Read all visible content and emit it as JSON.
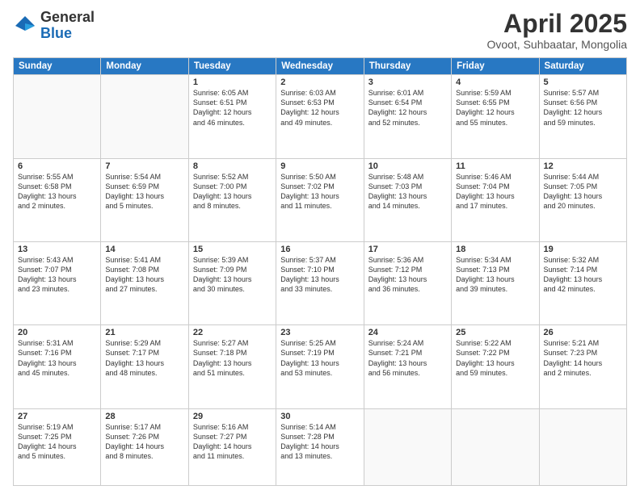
{
  "logo": {
    "general": "General",
    "blue": "Blue"
  },
  "title": "April 2025",
  "subtitle": "Ovoot, Suhbaatar, Mongolia",
  "days_header": [
    "Sunday",
    "Monday",
    "Tuesday",
    "Wednesday",
    "Thursday",
    "Friday",
    "Saturday"
  ],
  "weeks": [
    [
      {
        "day": "",
        "detail": ""
      },
      {
        "day": "",
        "detail": ""
      },
      {
        "day": "1",
        "detail": "Sunrise: 6:05 AM\nSunset: 6:51 PM\nDaylight: 12 hours\nand 46 minutes."
      },
      {
        "day": "2",
        "detail": "Sunrise: 6:03 AM\nSunset: 6:53 PM\nDaylight: 12 hours\nand 49 minutes."
      },
      {
        "day": "3",
        "detail": "Sunrise: 6:01 AM\nSunset: 6:54 PM\nDaylight: 12 hours\nand 52 minutes."
      },
      {
        "day": "4",
        "detail": "Sunrise: 5:59 AM\nSunset: 6:55 PM\nDaylight: 12 hours\nand 55 minutes."
      },
      {
        "day": "5",
        "detail": "Sunrise: 5:57 AM\nSunset: 6:56 PM\nDaylight: 12 hours\nand 59 minutes."
      }
    ],
    [
      {
        "day": "6",
        "detail": "Sunrise: 5:55 AM\nSunset: 6:58 PM\nDaylight: 13 hours\nand 2 minutes."
      },
      {
        "day": "7",
        "detail": "Sunrise: 5:54 AM\nSunset: 6:59 PM\nDaylight: 13 hours\nand 5 minutes."
      },
      {
        "day": "8",
        "detail": "Sunrise: 5:52 AM\nSunset: 7:00 PM\nDaylight: 13 hours\nand 8 minutes."
      },
      {
        "day": "9",
        "detail": "Sunrise: 5:50 AM\nSunset: 7:02 PM\nDaylight: 13 hours\nand 11 minutes."
      },
      {
        "day": "10",
        "detail": "Sunrise: 5:48 AM\nSunset: 7:03 PM\nDaylight: 13 hours\nand 14 minutes."
      },
      {
        "day": "11",
        "detail": "Sunrise: 5:46 AM\nSunset: 7:04 PM\nDaylight: 13 hours\nand 17 minutes."
      },
      {
        "day": "12",
        "detail": "Sunrise: 5:44 AM\nSunset: 7:05 PM\nDaylight: 13 hours\nand 20 minutes."
      }
    ],
    [
      {
        "day": "13",
        "detail": "Sunrise: 5:43 AM\nSunset: 7:07 PM\nDaylight: 13 hours\nand 23 minutes."
      },
      {
        "day": "14",
        "detail": "Sunrise: 5:41 AM\nSunset: 7:08 PM\nDaylight: 13 hours\nand 27 minutes."
      },
      {
        "day": "15",
        "detail": "Sunrise: 5:39 AM\nSunset: 7:09 PM\nDaylight: 13 hours\nand 30 minutes."
      },
      {
        "day": "16",
        "detail": "Sunrise: 5:37 AM\nSunset: 7:10 PM\nDaylight: 13 hours\nand 33 minutes."
      },
      {
        "day": "17",
        "detail": "Sunrise: 5:36 AM\nSunset: 7:12 PM\nDaylight: 13 hours\nand 36 minutes."
      },
      {
        "day": "18",
        "detail": "Sunrise: 5:34 AM\nSunset: 7:13 PM\nDaylight: 13 hours\nand 39 minutes."
      },
      {
        "day": "19",
        "detail": "Sunrise: 5:32 AM\nSunset: 7:14 PM\nDaylight: 13 hours\nand 42 minutes."
      }
    ],
    [
      {
        "day": "20",
        "detail": "Sunrise: 5:31 AM\nSunset: 7:16 PM\nDaylight: 13 hours\nand 45 minutes."
      },
      {
        "day": "21",
        "detail": "Sunrise: 5:29 AM\nSunset: 7:17 PM\nDaylight: 13 hours\nand 48 minutes."
      },
      {
        "day": "22",
        "detail": "Sunrise: 5:27 AM\nSunset: 7:18 PM\nDaylight: 13 hours\nand 51 minutes."
      },
      {
        "day": "23",
        "detail": "Sunrise: 5:25 AM\nSunset: 7:19 PM\nDaylight: 13 hours\nand 53 minutes."
      },
      {
        "day": "24",
        "detail": "Sunrise: 5:24 AM\nSunset: 7:21 PM\nDaylight: 13 hours\nand 56 minutes."
      },
      {
        "day": "25",
        "detail": "Sunrise: 5:22 AM\nSunset: 7:22 PM\nDaylight: 13 hours\nand 59 minutes."
      },
      {
        "day": "26",
        "detail": "Sunrise: 5:21 AM\nSunset: 7:23 PM\nDaylight: 14 hours\nand 2 minutes."
      }
    ],
    [
      {
        "day": "27",
        "detail": "Sunrise: 5:19 AM\nSunset: 7:25 PM\nDaylight: 14 hours\nand 5 minutes."
      },
      {
        "day": "28",
        "detail": "Sunrise: 5:17 AM\nSunset: 7:26 PM\nDaylight: 14 hours\nand 8 minutes."
      },
      {
        "day": "29",
        "detail": "Sunrise: 5:16 AM\nSunset: 7:27 PM\nDaylight: 14 hours\nand 11 minutes."
      },
      {
        "day": "30",
        "detail": "Sunrise: 5:14 AM\nSunset: 7:28 PM\nDaylight: 14 hours\nand 13 minutes."
      },
      {
        "day": "",
        "detail": ""
      },
      {
        "day": "",
        "detail": ""
      },
      {
        "day": "",
        "detail": ""
      }
    ]
  ]
}
